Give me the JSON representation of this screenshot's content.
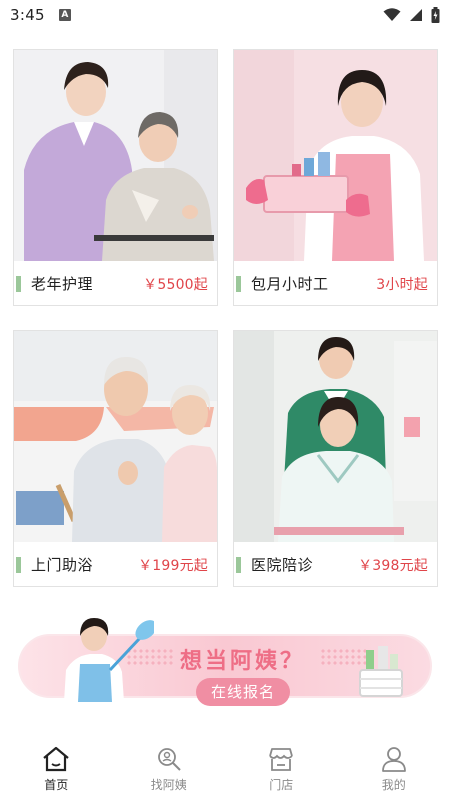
{
  "status_bar": {
    "time": "3:45",
    "notification_badge": "A"
  },
  "services": [
    {
      "label": "老年护理",
      "price": "￥5500起"
    },
    {
      "label": "包月小时工",
      "price": "3小时起"
    },
    {
      "label": "上门助浴",
      "price": "￥199元起"
    },
    {
      "label": "医院陪诊",
      "price": "￥398元起"
    }
  ],
  "banner": {
    "title": "想当阿姨？",
    "cta": "在线报名"
  },
  "tabs": [
    {
      "label": "首页",
      "icon": "home-icon",
      "active": true
    },
    {
      "label": "找阿姨",
      "icon": "search-person-icon",
      "active": false
    },
    {
      "label": "门店",
      "icon": "store-icon",
      "active": false
    },
    {
      "label": "我的",
      "icon": "profile-icon",
      "active": false
    }
  ],
  "colors": {
    "accent_price": "#e0454a",
    "label_bar": "#9bc79a",
    "banner_pink": "#ee6e86",
    "cta_pink": "#f08ea3"
  }
}
